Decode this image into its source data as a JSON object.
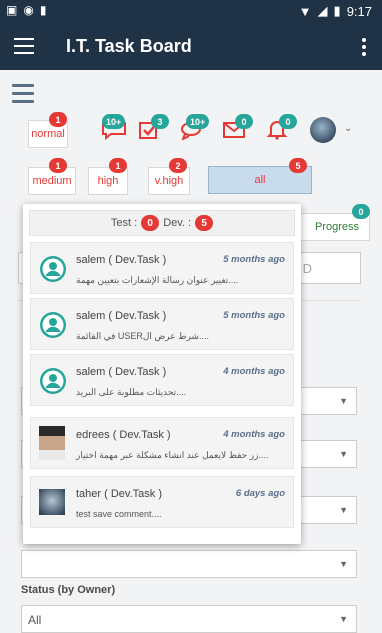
{
  "status_bar": {
    "time": "9:17"
  },
  "app_bar": {
    "title": "I.T. Task Board"
  },
  "priority": {
    "normal": {
      "label": "normal",
      "count": "1"
    },
    "medium": {
      "label": "medium",
      "count": "1"
    },
    "high": {
      "label": "high",
      "count": "1"
    },
    "vhigh": {
      "label": "v.high",
      "count": "2"
    },
    "all": {
      "label": "all",
      "count": "5"
    }
  },
  "toolbar_badges": {
    "chat": "10+",
    "tasks": "3",
    "comments": "10+",
    "mail": "0",
    "bell": "0"
  },
  "progress": {
    "label": "Progress",
    "count": "0"
  },
  "search_field": {
    "value": "D"
  },
  "popup": {
    "test_label": "Test :",
    "test_count": "0",
    "dev_label": "Dev. :",
    "dev_count": "5",
    "items": [
      {
        "name": "salem ( Dev.Task )",
        "time": "5 months ago",
        "message": "تغيير عنوان رسالة الإشعارات بتعيين مهمة....",
        "avatar": "teal-user-icon"
      },
      {
        "name": "salem ( Dev.Task )",
        "time": "5 months ago",
        "message": "في القائمة USERشرط عرض ال....",
        "avatar": "teal-user-icon"
      },
      {
        "name": "salem ( Dev.Task )",
        "time": "4 months ago",
        "message": "تحديثات مطلوبة على البريد....",
        "avatar": "teal-user-icon"
      },
      {
        "name": "edrees ( Dev.Task )",
        "time": "4 months ago",
        "message": "زر حفظ لايعمل عند انشاء مشكلة عبر مهمة اختيار....",
        "avatar": "photo-avatar"
      },
      {
        "name": "taher ( Dev.Task )",
        "time": "6 days ago",
        "message": "test save comment....",
        "avatar": "photo-avatar"
      }
    ]
  },
  "filters": {
    "status_owner_label": "Status (by Owner)",
    "status_owner_value": "All"
  },
  "colors": {
    "appbar": "#1f3246",
    "accent_red": "#e53935",
    "teal": "#26a69a"
  }
}
